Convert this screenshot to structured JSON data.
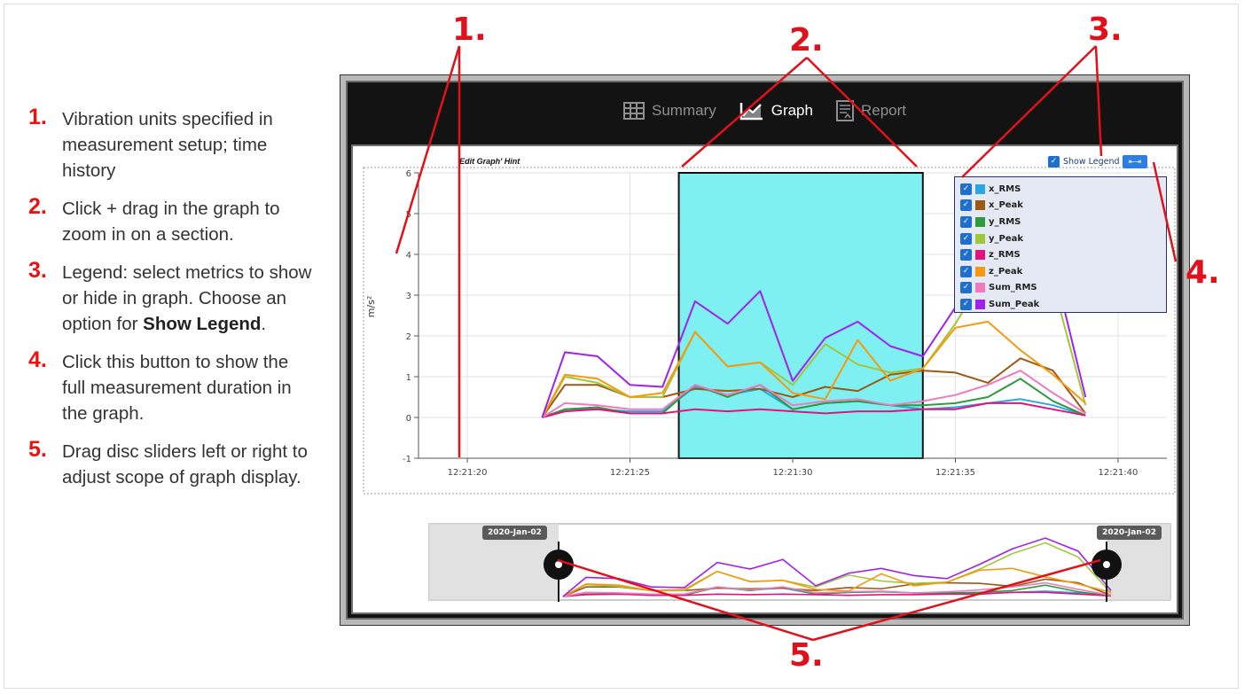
{
  "steps": [
    {
      "num": "1.",
      "text": "Vibration units specified in measurement setup; time history",
      "bold": ""
    },
    {
      "num": "2.",
      "text": "Click + drag in the graph to zoom in on a section.",
      "bold": ""
    },
    {
      "num": "3.",
      "text": "Legend: select metrics to show or hide in graph. Choose an option for ",
      "bold": "Show Legend",
      "tail": "."
    },
    {
      "num": "4.",
      "text": "Click this button to show the full measurement duration in the graph.",
      "bold": ""
    },
    {
      "num": "5.",
      "text": "Drag disc sliders left or right to adjust scope of graph display.",
      "bold": ""
    }
  ],
  "callouts": {
    "c1": "1.",
    "c2": "2.",
    "c3": "3.",
    "c4": "4.",
    "c5": "5."
  },
  "nav": {
    "summary": "Summary",
    "graph": "Graph",
    "report": "Report"
  },
  "hint": "'Edit Graph' Hint",
  "show_legend": "Show Legend",
  "slider": {
    "start_date": "2020-Jan-02",
    "end_date": "2020-Jan-02"
  },
  "colors": {
    "zoom_selection": "#7ff0f2",
    "accent": "#e0111a",
    "checkbox": "#1f6fcf"
  },
  "legend_items": [
    {
      "label": "x_RMS",
      "color": "#2aa7e0"
    },
    {
      "label": "x_Peak",
      "color": "#9a5a16"
    },
    {
      "label": "y_RMS",
      "color": "#2e9a3e"
    },
    {
      "label": "y_Peak",
      "color": "#9fc83a"
    },
    {
      "label": "z_RMS",
      "color": "#e0147a"
    },
    {
      "label": "z_Peak",
      "color": "#f59a10"
    },
    {
      "label": "Sum_RMS",
      "color": "#f07ac0"
    },
    {
      "label": "Sum_Peak",
      "color": "#a020f0"
    }
  ],
  "chart_data": {
    "type": "line",
    "ylabel": "m/s²",
    "ylim": [
      -1,
      6
    ],
    "y_ticks": [
      -1,
      0,
      1,
      2,
      3,
      4,
      5,
      6
    ],
    "xlim": [
      "12:21:18.5",
      "12:21:41.5"
    ],
    "x_ticks": [
      "12:21:20",
      "12:21:25",
      "12:21:30",
      "12:21:35",
      "12:21:40"
    ],
    "zoom_selection": {
      "from": "12:21:26.5",
      "to": "12:21:34"
    },
    "x": [
      "12:21:22.3",
      "12:21:23",
      "12:21:24",
      "12:21:25",
      "12:21:26",
      "12:21:27",
      "12:21:28",
      "12:21:29",
      "12:21:30",
      "12:21:31",
      "12:21:32",
      "12:21:33",
      "12:21:34",
      "12:21:35",
      "12:21:36",
      "12:21:37",
      "12:21:38",
      "12:21:39"
    ],
    "series": [
      {
        "name": "x_RMS",
        "values": [
          0,
          0.2,
          0.2,
          0.15,
          0.15,
          0.75,
          0.55,
          0.7,
          0.2,
          0.35,
          0.4,
          0.3,
          0.2,
          0.25,
          0.35,
          0.45,
          0.3,
          0.05
        ]
      },
      {
        "name": "x_Peak",
        "values": [
          0,
          0.8,
          0.8,
          0.5,
          0.5,
          0.7,
          0.65,
          0.7,
          0.5,
          0.75,
          0.65,
          1.05,
          1.15,
          1.1,
          0.85,
          1.45,
          1.15,
          0.1
        ]
      },
      {
        "name": "y_RMS",
        "values": [
          0,
          0.2,
          0.25,
          0.1,
          0.1,
          0.8,
          0.5,
          0.8,
          0.2,
          0.35,
          0.4,
          0.3,
          0.3,
          0.35,
          0.5,
          0.95,
          0.4,
          0.05
        ]
      },
      {
        "name": "y_Peak",
        "values": [
          0,
          1,
          0.85,
          0.5,
          0.5,
          2.1,
          1.25,
          1.35,
          0.8,
          1.8,
          1.3,
          1.1,
          1.2,
          2.3,
          3.6,
          4.5,
          3.3,
          0.3
        ]
      },
      {
        "name": "z_RMS",
        "values": [
          0,
          0.15,
          0.2,
          0.1,
          0.1,
          0.2,
          0.15,
          0.2,
          0.15,
          0.1,
          0.15,
          0.15,
          0.2,
          0.2,
          0.35,
          0.35,
          0.2,
          0.05
        ]
      },
      {
        "name": "z_Peak",
        "values": [
          0,
          1.05,
          0.95,
          0.5,
          0.6,
          2.1,
          1.25,
          1.35,
          0.6,
          0.45,
          1.9,
          0.9,
          1.2,
          2.2,
          2.35,
          1.65,
          1.05,
          0.35
        ]
      },
      {
        "name": "Sum_RMS",
        "values": [
          0,
          0.35,
          0.3,
          0.2,
          0.2,
          0.8,
          0.55,
          0.8,
          0.3,
          0.4,
          0.45,
          0.3,
          0.4,
          0.55,
          0.8,
          1.15,
          0.6,
          0.1
        ]
      },
      {
        "name": "Sum_Peak",
        "values": [
          0,
          1.6,
          1.5,
          0.8,
          0.75,
          2.85,
          2.3,
          3.1,
          0.9,
          1.95,
          2.35,
          1.75,
          1.5,
          2.7,
          4.0,
          4.9,
          3.8,
          0.5
        ]
      }
    ]
  }
}
